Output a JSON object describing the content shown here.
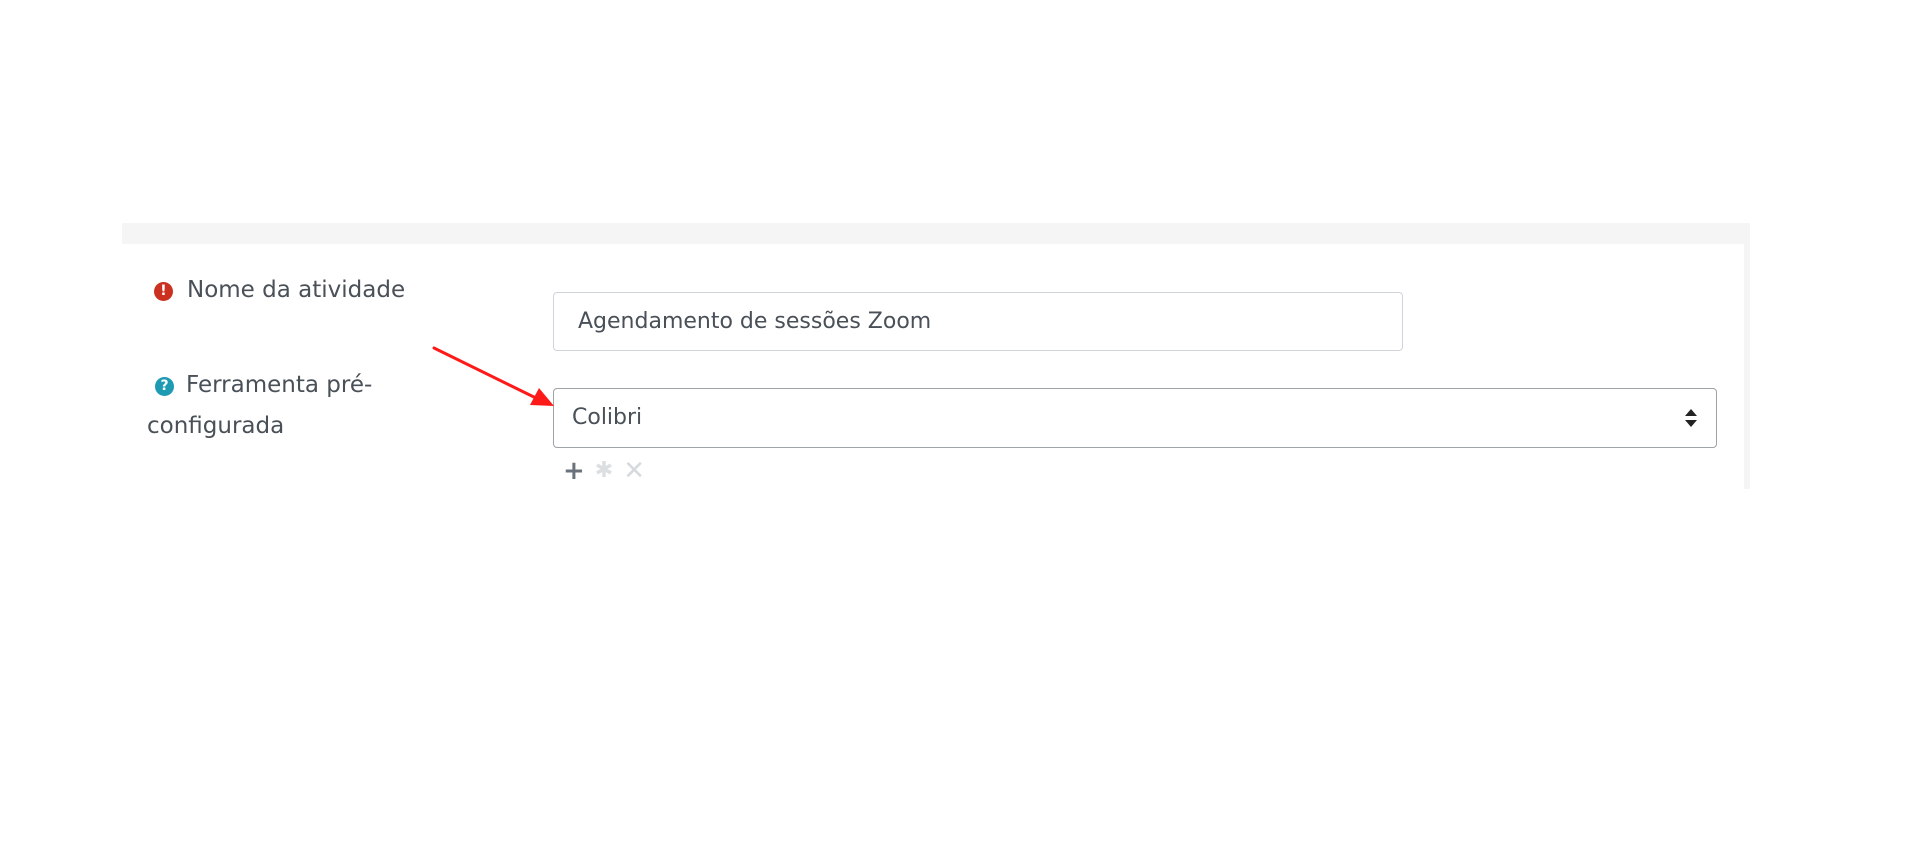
{
  "form": {
    "activity_name": {
      "label": "Nome da atividade",
      "required_icon": "exclamation-circle-icon",
      "value": "Agendamento de sessões Zoom"
    },
    "preconfigured_tool": {
      "label": "Ferramenta pré-configurada",
      "help_icon": "question-circle-icon",
      "selected": "Colibri",
      "actions": [
        {
          "name": "add-tool",
          "icon": "plus-icon",
          "symbol": "+"
        },
        {
          "name": "edit-tool",
          "icon": "gear-icon",
          "symbol": "✱"
        },
        {
          "name": "delete-tool",
          "icon": "close-icon",
          "symbol": "✕"
        }
      ]
    }
  },
  "colors": {
    "required": "#ca3120",
    "help": "#1f9ab3",
    "annotation_arrow": "#ff1a1a"
  }
}
